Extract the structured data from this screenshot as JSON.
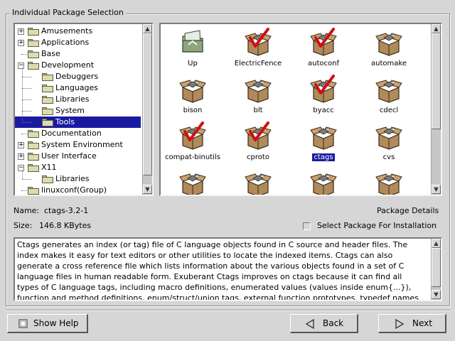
{
  "group_title": "Individual Package Selection",
  "tree": {
    "items": [
      {
        "label": "Amusements",
        "expander": "+",
        "depth": 0,
        "selected": false
      },
      {
        "label": "Applications",
        "expander": "+",
        "depth": 0,
        "selected": false
      },
      {
        "label": "Base",
        "expander": "",
        "depth": 0,
        "selected": false
      },
      {
        "label": "Development",
        "expander": "−",
        "depth": 0,
        "selected": false
      },
      {
        "label": "Debuggers",
        "expander": "",
        "depth": 1,
        "selected": false
      },
      {
        "label": "Languages",
        "expander": "",
        "depth": 1,
        "selected": false
      },
      {
        "label": "Libraries",
        "expander": "",
        "depth": 1,
        "selected": false
      },
      {
        "label": "System",
        "expander": "",
        "depth": 1,
        "selected": false
      },
      {
        "label": "Tools",
        "expander": "",
        "depth": 1,
        "selected": true
      },
      {
        "label": "Documentation",
        "expander": "",
        "depth": 0,
        "selected": false
      },
      {
        "label": "System Environment",
        "expander": "+",
        "depth": 0,
        "selected": false
      },
      {
        "label": "User Interface",
        "expander": "+",
        "depth": 0,
        "selected": false
      },
      {
        "label": "X11",
        "expander": "−",
        "depth": 0,
        "selected": false
      },
      {
        "label": "Libraries",
        "expander": "",
        "depth": 1,
        "selected": false
      },
      {
        "label": "linuxconf(Group)",
        "expander": "",
        "depth": 0,
        "selected": false
      }
    ]
  },
  "packages": [
    {
      "label": "Up",
      "icon": "up-folder-icon",
      "checked": false,
      "selected": false
    },
    {
      "label": "ElectricFence",
      "icon": "package-icon",
      "checked": true,
      "selected": false
    },
    {
      "label": "autoconf",
      "icon": "package-icon",
      "checked": true,
      "selected": false
    },
    {
      "label": "automake",
      "icon": "package-icon",
      "checked": false,
      "selected": false
    },
    {
      "label": "bison",
      "icon": "package-icon",
      "checked": false,
      "selected": false
    },
    {
      "label": "blt",
      "icon": "package-icon",
      "checked": false,
      "selected": false
    },
    {
      "label": "byacc",
      "icon": "package-icon",
      "checked": true,
      "selected": false
    },
    {
      "label": "cdecl",
      "icon": "package-icon",
      "checked": false,
      "selected": false
    },
    {
      "label": "compat-binutils",
      "icon": "package-icon",
      "checked": true,
      "selected": false
    },
    {
      "label": "cproto",
      "icon": "package-icon",
      "checked": true,
      "selected": false
    },
    {
      "label": "ctags",
      "icon": "package-icon",
      "checked": false,
      "selected": true
    },
    {
      "label": "cvs",
      "icon": "package-icon",
      "checked": false,
      "selected": false
    },
    {
      "label": "",
      "icon": "package-icon",
      "checked": false,
      "selected": false
    },
    {
      "label": "",
      "icon": "package-icon",
      "checked": false,
      "selected": false
    },
    {
      "label": "",
      "icon": "package-icon",
      "checked": false,
      "selected": false
    },
    {
      "label": "",
      "icon": "package-icon",
      "checked": false,
      "selected": false
    }
  ],
  "details": {
    "name_label": "Name:",
    "name_value": "ctags-3.2-1",
    "size_label": "Size:",
    "size_value": "146.8 KBytes",
    "details_title": "Package Details",
    "select_label": "Select Package For Installation",
    "select_checked": false,
    "description": "Ctags generates an index (or tag) file of C language objects found in C source and header files.  The\nindex makes it easy for text editors or other utilities to locate the indexed items.  Ctags can also\ngenerate a cross reference file which lists information about the various objects found in a set of C\nlanguage files in human readable form.  Exuberant Ctags improves on ctags because it can find all\ntypes of C language tags, including macro definitions, enumerated values (values inside enum{...}),\nfunction and method definitions, enum/struct/union tags, external function prototypes, typedef names"
  },
  "buttons": {
    "help": "Show Help",
    "back": "Back",
    "next": "Next"
  },
  "colors": {
    "selection": "#1a1aa0",
    "checkmark": "#d01010",
    "box": "#b08a5a"
  }
}
